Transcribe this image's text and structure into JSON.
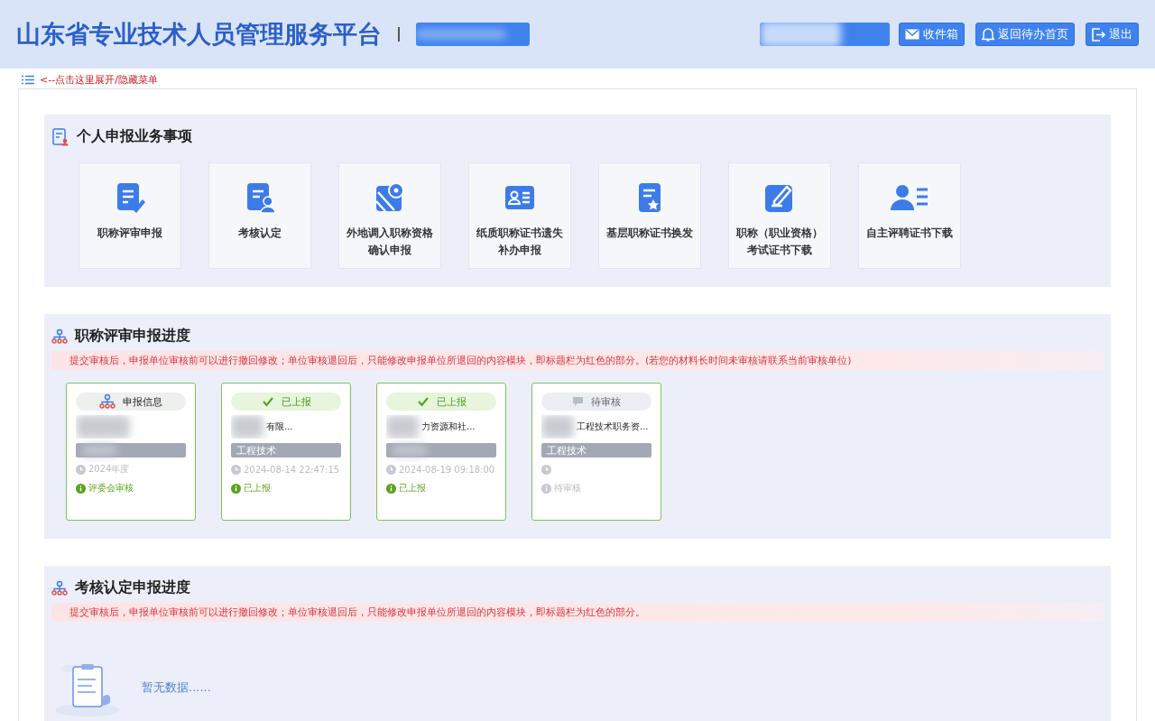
{
  "header": {
    "title": "山东省专业技术人员管理服务平台",
    "buttons": [
      {
        "kind": "mail",
        "label": "收件箱"
      },
      {
        "kind": "bell",
        "label": "返回待办首页"
      },
      {
        "kind": "exit",
        "label": "退出"
      }
    ]
  },
  "menu_toggle": {
    "label": "<--点击这里展开/隐藏菜单"
  },
  "services": {
    "title": "个人申报业务事项",
    "items": [
      {
        "kind": "doc-edit",
        "label": "职称评审申报"
      },
      {
        "kind": "doc-user",
        "label": "考核认定"
      },
      {
        "kind": "map",
        "label": "外地调入职称资格确认申报"
      },
      {
        "kind": "id-card",
        "label": "纸质职称证书遗失补办申报"
      },
      {
        "kind": "doc-star",
        "label": "基层职称证书换发"
      },
      {
        "kind": "pen",
        "label": "职称（职业资格）考试证书下载"
      },
      {
        "kind": "user-list",
        "label": "自主评聘证书下载"
      }
    ]
  },
  "progress": {
    "title": "职称评审申报进度",
    "notice": "提交审核后，申报单位审核前可以进行撤回修改；单位审核退回后，只能修改申报单位所退回的内容模块，即标题栏为红色的部分。(若您的材料长时间未审核请联系当前审核单位)",
    "cards": [
      {
        "kind": "info",
        "header": "申报信息",
        "time": "2024年度",
        "state": "评委会审核"
      },
      {
        "kind": "uploaded",
        "header": "已上报",
        "org": "有限...",
        "category": "工程技术",
        "time": "2024-08-14 22:47:15",
        "state": "已上报"
      },
      {
        "kind": "uploaded",
        "header": "已上报",
        "org": "力资源和社...",
        "time": "2024-08-19 09:18:00",
        "state": "已上报"
      },
      {
        "kind": "pending",
        "header": "待审核",
        "org": "工程技术职务资...",
        "category": "工程技术",
        "state": "待审核"
      }
    ]
  },
  "assessment": {
    "title": "考核认定申报进度",
    "notice": "提交审核后，申报单位审核前可以进行撤回修改；单位审核退回后，只能修改申报单位所退回的内容模块，即标题栏为红色的部分。",
    "empty": "暂无数据......"
  }
}
